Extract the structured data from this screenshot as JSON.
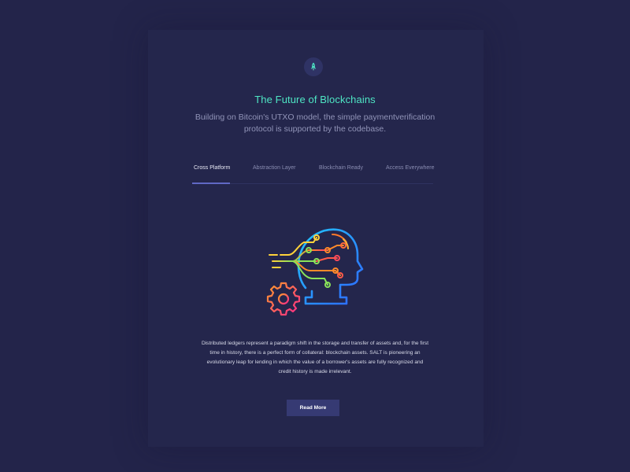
{
  "section": {
    "icon": "rocket-icon",
    "title": "The Future of Blockchains",
    "subtitle": "Building on Bitcoin's UTXO model, the simple paymentverification protocol is supported by the codebase."
  },
  "tabs": [
    {
      "label": "Cross Platform",
      "active": true
    },
    {
      "label": "Abstraction Layer",
      "active": false
    },
    {
      "label": "Blockchain Ready",
      "active": false
    },
    {
      "label": "Access Everywhere",
      "active": false
    }
  ],
  "content": {
    "illustration": "ai-head-gear-icon",
    "body": "Distributed ledgers represent a paradigm shift in the storage and transfer of assets and, for the first time in history, there is a perfect form of collateral: blockchain assets. SALT is pioneering an evolutionary leap for lending in which the value of a borrower's assets are fully recognized and credit history is made irrelevant.",
    "button_label": "Read More"
  },
  "colors": {
    "background": "#23244a",
    "title": "#4ee6c4",
    "tab_active_underline": "#6068c4",
    "button": "#363a73"
  }
}
